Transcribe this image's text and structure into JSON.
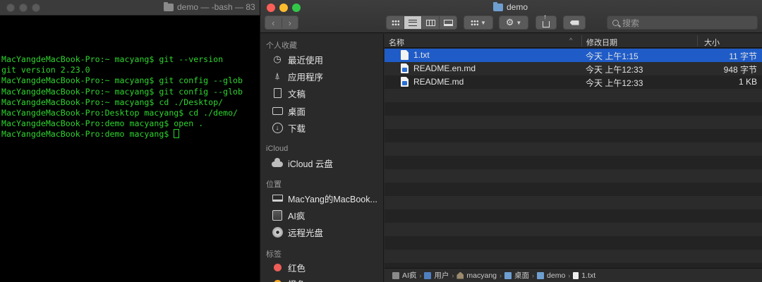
{
  "terminal": {
    "title": "demo — -bash — 83",
    "lines": [
      "MacYangdeMacBook-Pro:~ macyang$ git --version",
      "git version 2.23.0",
      "MacYangdeMacBook-Pro:~ macyang$ git config --glob",
      "MacYangdeMacBook-Pro:~ macyang$ git config --glob",
      "MacYangdeMacBook-Pro:~ macyang$ cd ./Desktop/",
      "MacYangdeMacBook-Pro:Desktop macyang$ cd ./demo/",
      "MacYangdeMacBook-Pro:demo macyang$ open .",
      "MacYangdeMacBook-Pro:demo macyang$ "
    ],
    "text_color": "#2ed42e"
  },
  "finder": {
    "title": "demo",
    "search_placeholder": "搜索",
    "nav": {
      "back": "‹",
      "forward": "›"
    },
    "accent": "#1f5cc8",
    "sidebar": {
      "favorites_header": "个人收藏",
      "favorites": [
        {
          "label": "最近使用",
          "icon": "clock-icon"
        },
        {
          "label": "应用程序",
          "icon": "applications-icon"
        },
        {
          "label": "文稿",
          "icon": "document-icon"
        },
        {
          "label": "桌面",
          "icon": "desktop-icon"
        },
        {
          "label": "下载",
          "icon": "download-icon"
        }
      ],
      "icloud_header": "iCloud",
      "icloud": [
        {
          "label": "iCloud 云盘",
          "icon": "cloud-icon"
        }
      ],
      "locations_header": "位置",
      "locations": [
        {
          "label": "MacYang的MacBook...",
          "icon": "laptop-icon"
        },
        {
          "label": "AI疯",
          "icon": "disk-icon"
        },
        {
          "label": "远程光盘",
          "icon": "cd-icon"
        }
      ],
      "tags_header": "标签",
      "tags": [
        {
          "label": "红色",
          "color": "#ee5e58"
        },
        {
          "label": "橙色",
          "color": "#f5a623"
        }
      ]
    },
    "columns": {
      "name": "名称",
      "date": "修改日期",
      "size": "大小"
    },
    "files": [
      {
        "name": "1.txt",
        "date": "今天 上午1:15",
        "size": "11 字节",
        "selected": true
      },
      {
        "name": "README.en.md",
        "date": "今天 上午12:33",
        "size": "948 字节",
        "selected": false
      },
      {
        "name": "README.md",
        "date": "今天 上午12:33",
        "size": "1 KB",
        "selected": false
      }
    ],
    "path": [
      "AI疯",
      "用户",
      "macyang",
      "桌面",
      "demo",
      "1.txt"
    ]
  }
}
